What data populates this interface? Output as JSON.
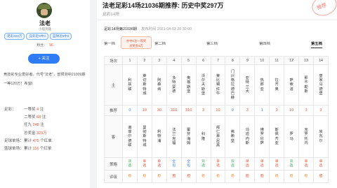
{
  "profile": {
    "name": "法老",
    "subtitle": "小喵英雄",
    "tags": [
      "足彩323万",
      "竞彩近5中4",
      "篮球近5中2"
    ],
    "fans_label": "粉丝：",
    "fans": "96",
    "follow_label": "+ 关注",
    "description": "竞技彩专业爱好者，代号“法老”，曾预测中21009期一等120万！希望I",
    "stats": [
      {
        "label": "足彩：",
        "text": "一等奖",
        "value": "4",
        "unit": "注"
      },
      {
        "label": "",
        "text": "二等奖",
        "value": "68",
        "unit": "注"
      },
      {
        "label": "",
        "text": "任九",
        "value": "248",
        "unit": "注"
      },
      {
        "label": "",
        "text": "总奖金",
        "value": "323万",
        "unit": ""
      },
      {
        "label": "足球单场：",
        "text": "累计",
        "value": "475",
        "unit": "个红单"
      },
      {
        "label": "篮球单场：",
        "text": "累计",
        "value": "116",
        "unit": "个红单"
      }
    ]
  },
  "article": {
    "title": "法老足彩14场21036期推荐: 历史中奖297万",
    "subtitle": "足彩14场",
    "stamp": "推荐",
    "meta_title": "足彩14场第21036期",
    "publish": "发布时间 2021-04-03 20:30:00",
    "stages": [
      "第一档",
      "第二档",
      "第三档",
      "第四档",
      "第五档"
    ],
    "active_stage": "第五档",
    "bubble": [
      "亦中1注一等奖",
      "总奖金8万"
    ]
  },
  "table": {
    "labels": {
      "field": "场次",
      "home": "主",
      "recommend": "推荐",
      "away": "客",
      "strategy": "策略",
      "rating": "评级"
    },
    "matches": [
      {
        "no": "1",
        "home": "利兹联",
        "rec": "0",
        "away": "谢菲尔德联",
        "strategy": "双选",
        "rating": "稳"
      },
      {
        "no": "2",
        "home": "莱切斯特城",
        "rec": "10",
        "away": "曼彻斯特城",
        "strategy": "单选",
        "rating": "稳"
      },
      {
        "no": "3",
        "home": "阿森纳",
        "rec": "30",
        "away": "利物浦",
        "strategy": "单选",
        "rating": "稳"
      },
      {
        "no": "4",
        "home": "多特蒙德",
        "rec": "310",
        "away": "法兰克福",
        "strategy": "全包",
        "rating": "胆"
      },
      {
        "no": "5",
        "home": "奥格斯堡",
        "rec": "310",
        "away": "霍芬海姆",
        "strategy": "全包",
        "rating": "胆"
      },
      {
        "no": "6",
        "home": "沃尔夫斯堡",
        "rec": "3",
        "away": "科隆",
        "strategy": "双选",
        "rating": "稳"
      },
      {
        "no": "7",
        "home": "莱比锡红牛",
        "rec": "10",
        "away": "拜仁慕尼黑",
        "strategy": "单选",
        "rating": "稳"
      },
      {
        "no": "8",
        "home": "门兴格拉德巴赫",
        "rec": "0",
        "away": "弗赖堡",
        "strategy": "双选",
        "rating": "稳"
      },
      {
        "no": "9",
        "home": "亚特兰大",
        "rec": "3",
        "away": "乌迪内斯",
        "strategy": "单选",
        "rating": "胆"
      },
      {
        "no": "10",
        "home": "热那亚",
        "rec": "1",
        "away": "佛罗伦萨",
        "strategy": "单选",
        "rating": "胆"
      },
      {
        "no": "11",
        "home": "拉齐奥",
        "rec": "3",
        "away": "斯佩齐亚",
        "strategy": "单选",
        "rating": "稳"
      },
      {
        "no": "12",
        "home": "萨索洛",
        "rec": "10",
        "away": "罗马",
        "strategy": "双选",
        "rating": "稳"
      },
      {
        "no": "13",
        "home": "那不勒斯",
        "rec": "3",
        "away": "克罗托内",
        "strategy": "单选",
        "rating": "稳"
      },
      {
        "no": "14",
        "home": "皇家马德里",
        "rec": "3",
        "away": "埃瓦尔",
        "strategy": "单选",
        "rating": "胆"
      }
    ]
  },
  "colors": {
    "accent": "#2f7cf6",
    "highlight": "#e8522f"
  }
}
